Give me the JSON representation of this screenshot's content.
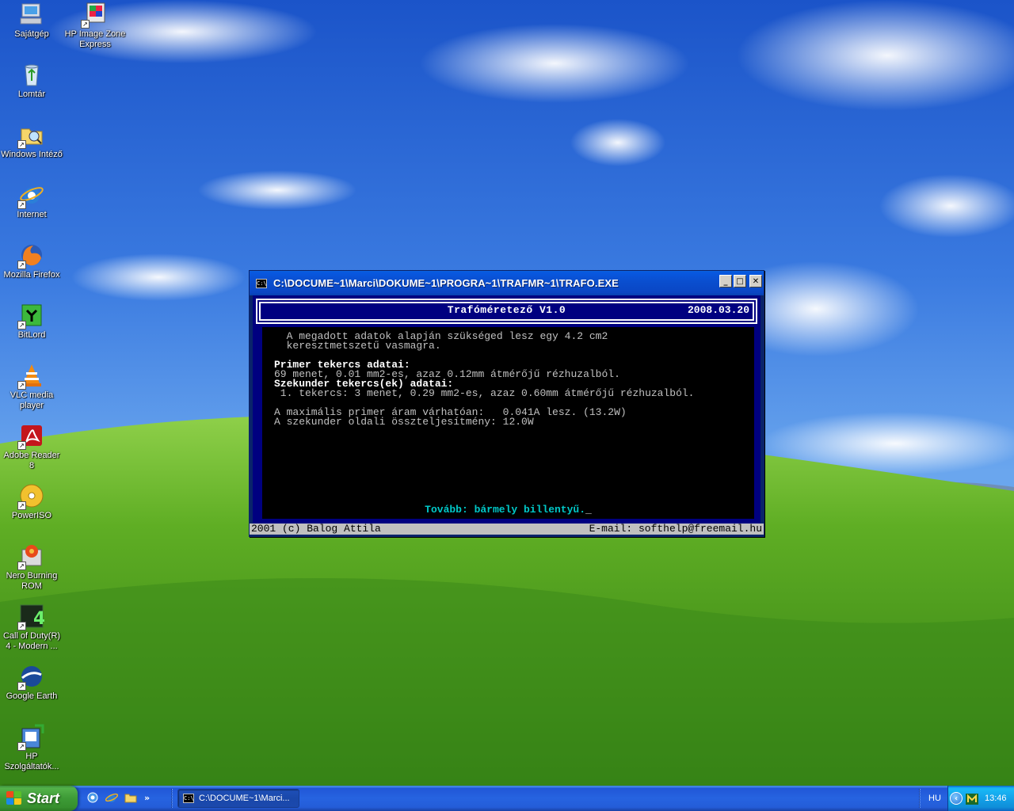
{
  "desktop": {
    "icons": [
      {
        "label": "Sajátgép",
        "icon": "my-computer-icon"
      },
      {
        "label": "HP Image Zone Express",
        "icon": "hp-image-zone-icon"
      },
      {
        "label": "Lomtár",
        "icon": "recycle-bin-icon"
      },
      {
        "label": "Windows Intéző",
        "icon": "windows-explorer-icon"
      },
      {
        "label": "Internet",
        "icon": "internet-explorer-icon"
      },
      {
        "label": "Mozilla Firefox",
        "icon": "firefox-icon"
      },
      {
        "label": "BitLord",
        "icon": "bitlord-icon"
      },
      {
        "label": "VLC media player",
        "icon": "vlc-icon"
      },
      {
        "label": "Adobe Reader 8",
        "icon": "adobe-reader-icon"
      },
      {
        "label": "PowerISO",
        "icon": "poweriso-icon"
      },
      {
        "label": "Nero Burning ROM",
        "icon": "nero-icon"
      },
      {
        "label": "Call of Duty(R) 4 - Modern ...",
        "icon": "call-of-duty-icon"
      },
      {
        "label": "Google Earth",
        "icon": "google-earth-icon"
      },
      {
        "label": "HP Szolgáltatók...",
        "icon": "hp-services-icon"
      }
    ]
  },
  "window": {
    "title": "C:\\DOCUME~1\\Marci\\DOKUME~1\\PROGRA~1\\TRAFMR~1\\TRAFO.EXE",
    "sys_icon": "C:\\",
    "minimize": "_",
    "maximize": "□",
    "close": "✕"
  },
  "console": {
    "app_title": "Trafóméretező V1.0",
    "date": "2008.03.20",
    "lines": [
      {
        "text": "  A megadott adatok alapján szükséged lesz egy 4.2 cm2",
        "bold": false
      },
      {
        "text": "  keresztmetszetű vasmagra.",
        "bold": false
      },
      {
        "text": "",
        "bold": false
      },
      {
        "text": "Primer tekercs adatai:",
        "bold": true
      },
      {
        "text": "69 menet, 0.01 mm2-es, azaz 0.12mm átmérőjű rézhuzalból.",
        "bold": false
      },
      {
        "text": "Szekunder tekercs(ek) adatai:",
        "bold": true
      },
      {
        "text": " 1. tekercs: 3 menet, 0.29 mm2-es, azaz 0.60mm átmérőjű rézhuzalból.",
        "bold": false
      },
      {
        "text": "",
        "bold": false
      },
      {
        "text": "A maximális primer áram várhatóan:   0.041A lesz. (13.2W)",
        "bold": false
      },
      {
        "text": "A szekunder oldali összteljesítmény: 12.0W",
        "bold": false
      }
    ],
    "prompt": "Tovább: bármely billentyű.",
    "cursor": "_",
    "status_left": "2001 (c) Balog Attila",
    "status_right": "E-mail: softhelp@freemail.hu"
  },
  "taskbar": {
    "start_label": "Start",
    "quick_launch": [
      "internet-explorer-icon",
      "ie-icon",
      "folder-icon"
    ],
    "more": "»",
    "task_button": {
      "label": "C:\\DOCUME~1\\Marci...",
      "icon": "C:\\"
    },
    "lang": "HU",
    "clock": "13:46"
  },
  "colors": {
    "console_bg": "#000000",
    "console_frame": "#000080",
    "prompt": "#00c8c8",
    "taskbar": "#245dd8",
    "start": "#3d9a36"
  }
}
